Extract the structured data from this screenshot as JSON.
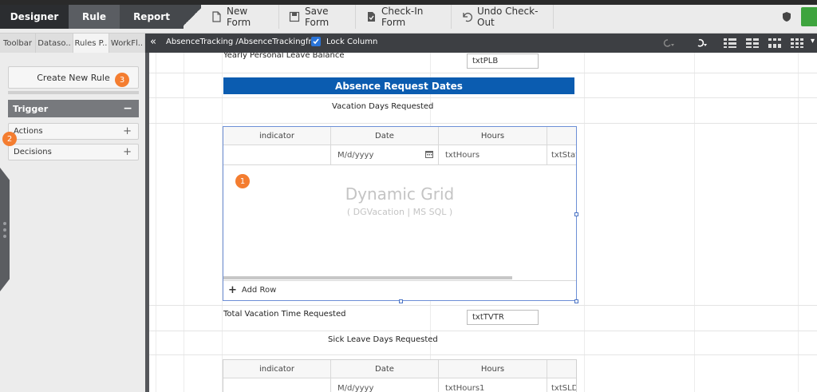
{
  "topbar": {
    "tabs": [
      "Designer",
      "Rule",
      "Report"
    ],
    "buttons": [
      "New Form",
      "Save Form",
      "Check-In Form",
      "Undo Check-Out"
    ]
  },
  "sidebar": {
    "tabs": [
      "Toolbar",
      "Dataso..",
      "Rules P..",
      "WorkFl.."
    ],
    "create_rule": "Create New Rule",
    "trigger": {
      "label": "Trigger",
      "toggle": "−"
    },
    "actions": {
      "label": "Actions",
      "toggle": "+"
    },
    "decisions": {
      "label": "Decisions",
      "toggle": "+"
    }
  },
  "pathbar": {
    "collapse": "«",
    "path": "AbsenceTracking /AbsenceTrackingfrm",
    "lock_label": "Lock Column",
    "lock_checked": true
  },
  "canvas": {
    "top_label": "Yearly Personal Leave Balance",
    "top_field": "txtPLB",
    "section_header": "Absence Request Dates",
    "vacation_label": "Vacation Days Requested",
    "grid1": {
      "columns": [
        "indicator",
        "Date",
        "Hours"
      ],
      "row": [
        "",
        "M/d/yyyy",
        "txtHours",
        "txtStat"
      ],
      "title": "Dynamic Grid",
      "subtitle": "( DGVacation | MS SQL )",
      "add_row": "Add Row"
    },
    "total_label": "Total Vacation Time Requested",
    "total_field": "txtTVTR",
    "sick_label": "Sick Leave Days Requested",
    "grid2": {
      "columns": [
        "indicator",
        "Date",
        "Hours"
      ],
      "row": [
        "",
        "M/d/yyyy",
        "txtHours1",
        "txtSLD"
      ]
    }
  },
  "badges": [
    "1",
    "2",
    "3"
  ],
  "colors": {
    "section_blue": "#0b5cb0",
    "badge_orange": "#f47d30",
    "dark_bar": "#3d3f43"
  }
}
